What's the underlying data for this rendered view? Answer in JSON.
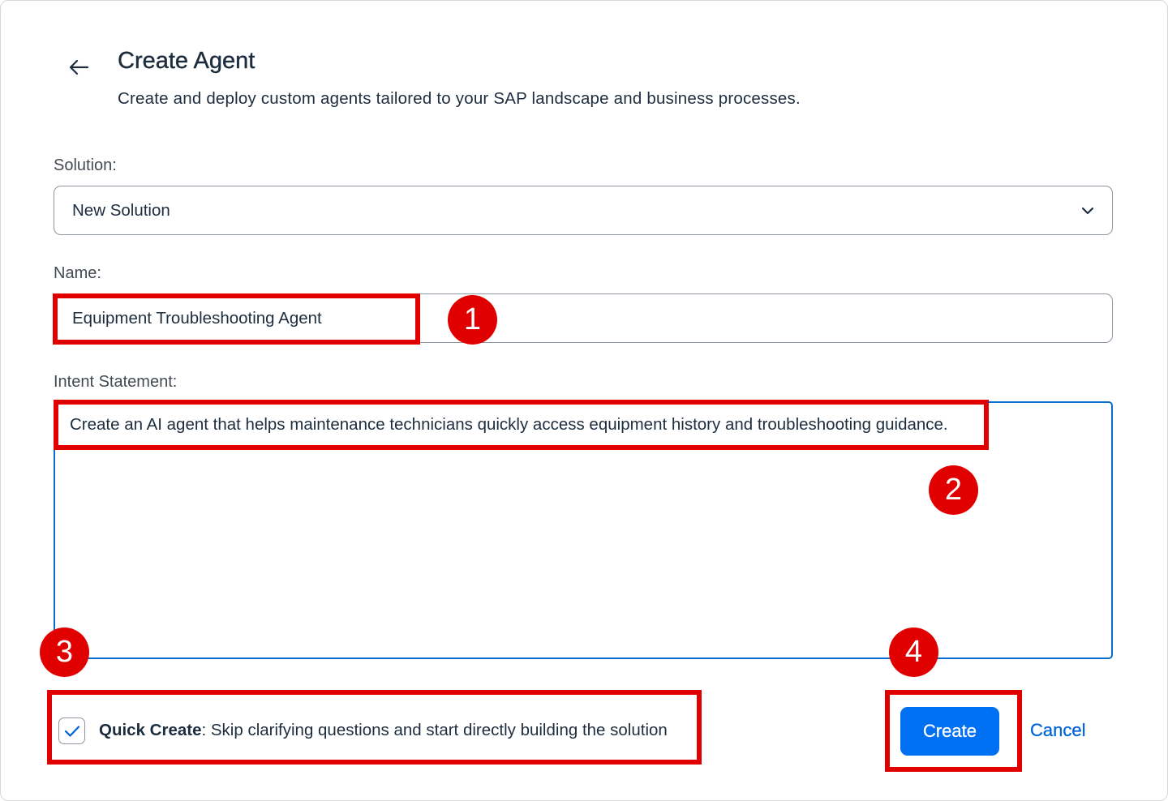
{
  "header": {
    "title": "Create Agent",
    "subtitle": "Create and deploy custom agents tailored to your SAP landscape and business processes."
  },
  "form": {
    "solution_label": "Solution:",
    "solution_value": "New Solution",
    "name_label": "Name:",
    "name_value": "Equipment Troubleshooting Agent",
    "intent_label": "Intent Statement:",
    "intent_value": "Create an AI agent that helps maintenance technicians quickly access equipment history and troubleshooting guidance."
  },
  "quick_create": {
    "checked": true,
    "title": "Quick Create",
    "description": ": Skip clarifying questions and start directly building the solution"
  },
  "actions": {
    "create_label": "Create",
    "cancel_label": "Cancel"
  },
  "annotations": {
    "badges": [
      "1",
      "2",
      "3",
      "4"
    ],
    "color": "#e00000"
  },
  "colors": {
    "primary": "#0070f2",
    "link": "#0064d9",
    "text": "#1d2d3e",
    "focus_border": "#0a6ed1"
  },
  "icons": {
    "back": "arrow-left-icon",
    "dropdown": "chevron-down-icon",
    "check": "checkmark-icon"
  }
}
